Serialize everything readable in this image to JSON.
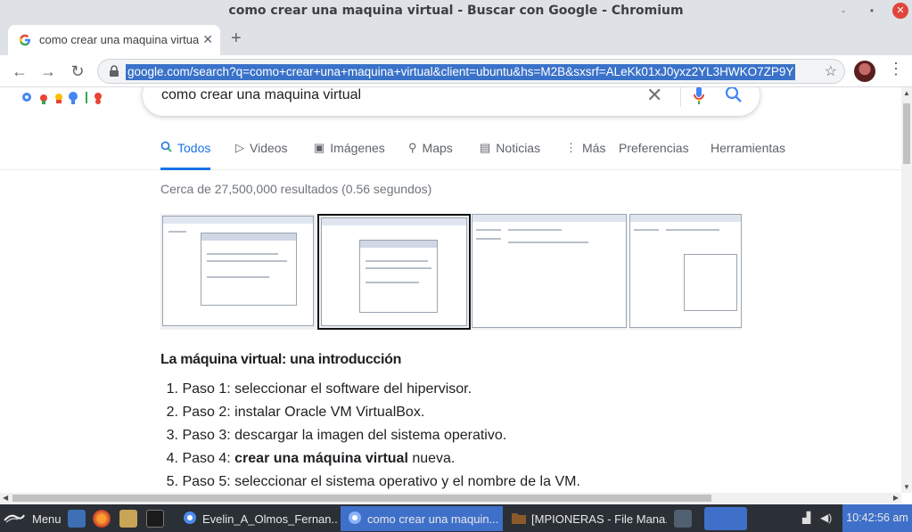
{
  "window": {
    "title": "como crear una maquina virtual - Buscar con Google - Chromium",
    "minimize": "-",
    "restore": "•",
    "close": "✕"
  },
  "tab": {
    "title": "como crear una maquina virtual - Buscar con Google",
    "close": "✕",
    "new_tab": "+"
  },
  "toolbar": {
    "back": "←",
    "forward": "→",
    "reload": "↻",
    "url": "google.com/search?q=como+crear+una+maquina+virtual&client=ubuntu&hs=M2B&sxsrf=ALeKk01xJ0yxz2YL3HWKO7ZP9Y",
    "star": "☆",
    "menu": "⋮"
  },
  "search": {
    "query": "como crear una maquina virtual",
    "clear": "✕"
  },
  "search_tabs": [
    {
      "label": "Todos",
      "icon": "search-icon",
      "glyph": "🔍",
      "active": true
    },
    {
      "label": "Videos",
      "icon": "video-icon",
      "glyph": "▷"
    },
    {
      "label": "Imágenes",
      "icon": "image-icon",
      "glyph": "▣"
    },
    {
      "label": "Maps",
      "icon": "map-pin-icon",
      "glyph": "⚲"
    },
    {
      "label": "Noticias",
      "icon": "news-icon",
      "glyph": "▤"
    },
    {
      "label": "Más",
      "icon": "more-icon",
      "glyph": "⋮"
    },
    {
      "label": "Preferencias"
    },
    {
      "label": "Herramientas"
    }
  ],
  "stats": "Cerca de 27,500,000 resultados (0.56 segundos)",
  "featured": {
    "title": "La máquina virtual: una introducción",
    "steps": [
      {
        "num": "1.",
        "pre": "Paso 1: seleccionar el software del hipervisor.",
        "bold": "",
        "post": ""
      },
      {
        "num": "2.",
        "pre": "Paso 2: instalar Oracle VM VirtualBox.",
        "bold": "",
        "post": ""
      },
      {
        "num": "3.",
        "pre": "Paso 3: descargar la imagen del sistema operativo.",
        "bold": "",
        "post": ""
      },
      {
        "num": "4.",
        "pre": "Paso 4: ",
        "bold": "crear una máquina virtual",
        "post": " nueva."
      },
      {
        "num": "5.",
        "pre": "Paso 5: seleccionar el sistema operativo y el nombre de la VM.",
        "bold": "",
        "post": ""
      }
    ]
  },
  "taskbar": {
    "menu_label": "Menu",
    "tasks": [
      {
        "label": "Evelin_A_Olmos_Fernan...",
        "icon": "chromium-icon"
      },
      {
        "label": "como crear una maquin...",
        "icon": "chromium-icon",
        "active": true
      },
      {
        "label": "[MPIONERAS - File Mana...",
        "icon": "folder-icon"
      }
    ],
    "clock": "10:42:56 am"
  },
  "colors": {
    "accent": "#1a73e8",
    "taskbar": "#2b2f36",
    "taskbar_active": "#3f70c9",
    "url_selection": "#3a72c9"
  }
}
